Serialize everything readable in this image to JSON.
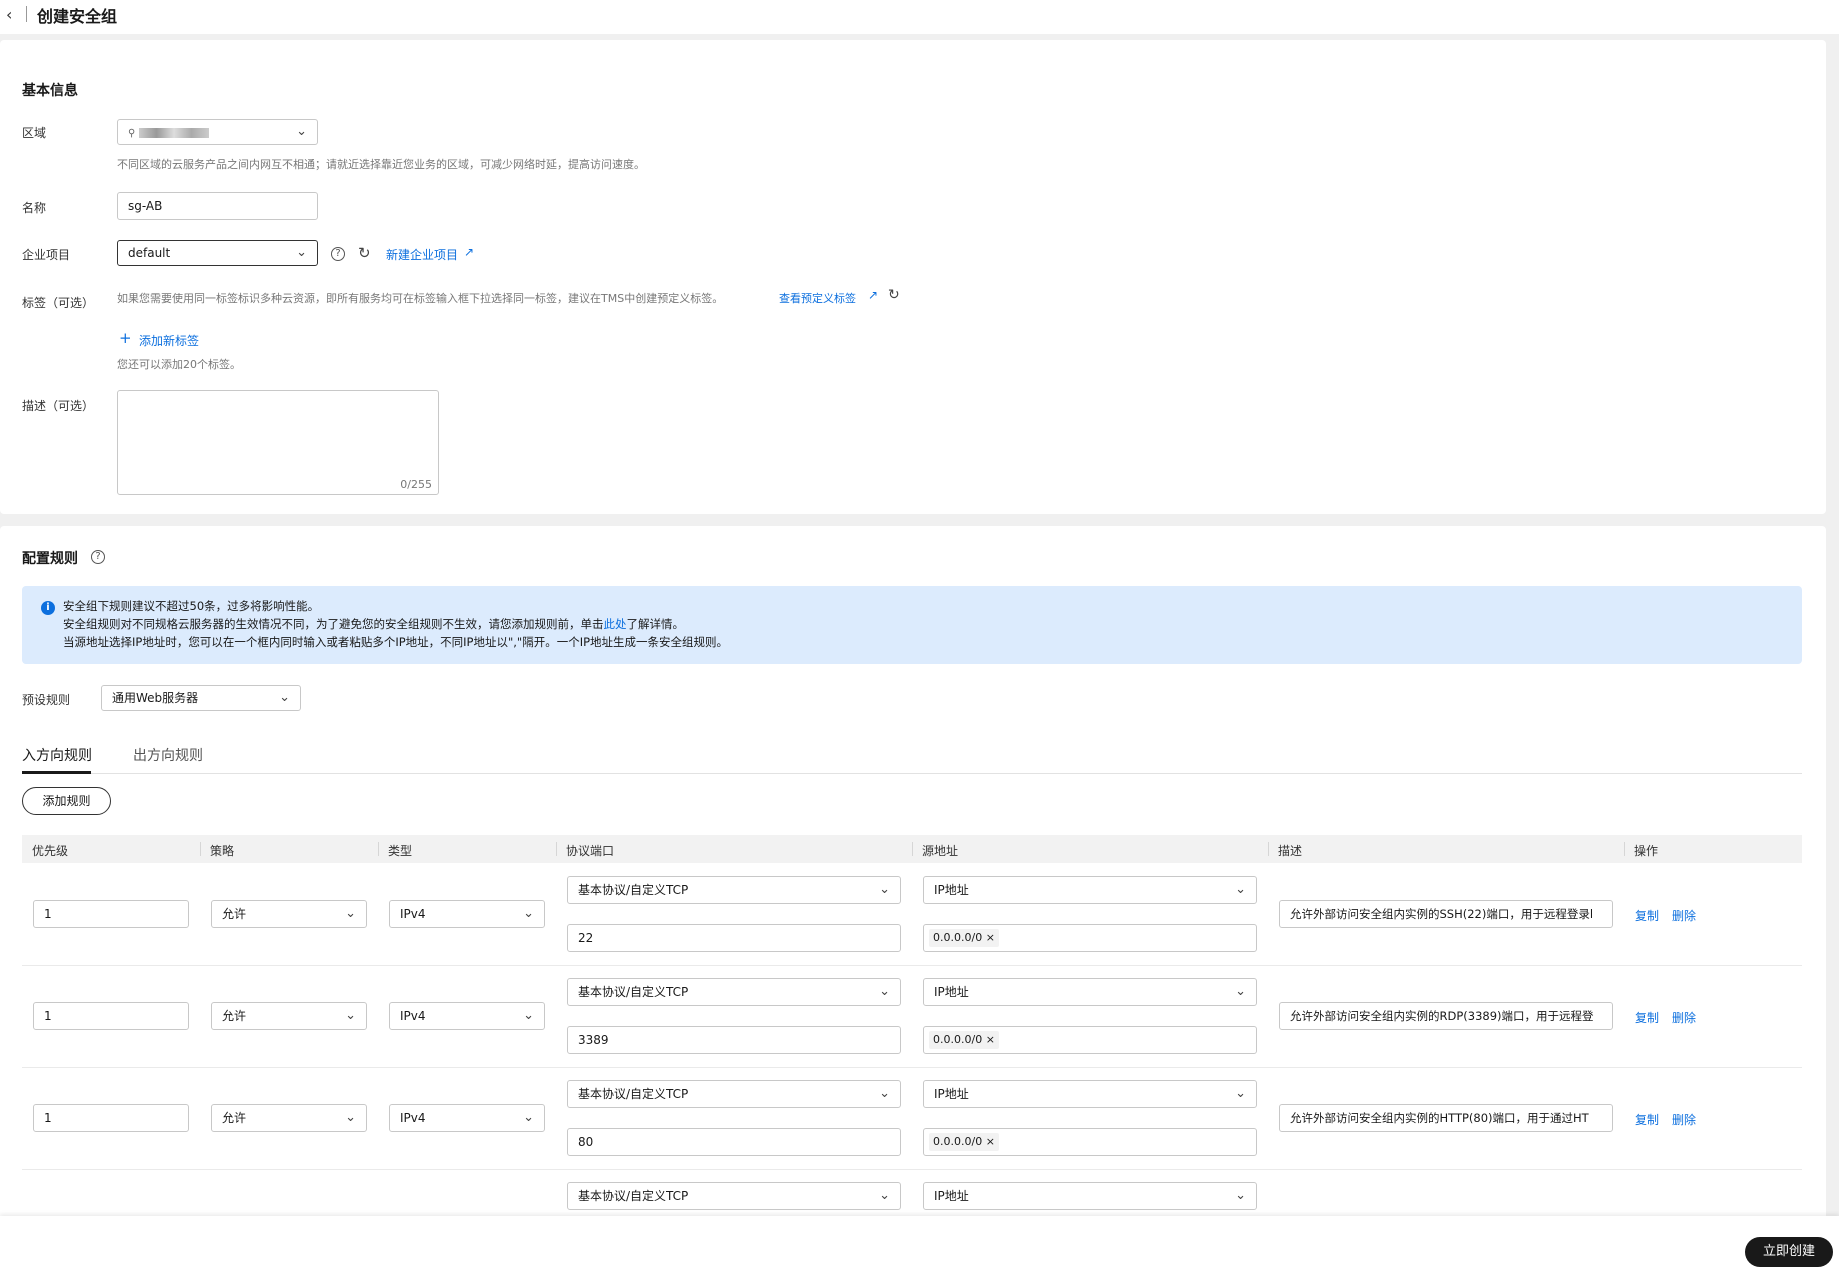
{
  "page": {
    "title": "创建安全组"
  },
  "basic": {
    "section_title": "基本信息",
    "region_label": "区域",
    "region_hint": "不同区域的云服务产品之间内网互不相通；请就近选择靠近您业务的区域，可减少网络时延，提高访问速度。",
    "name_label": "名称",
    "name_value": "sg-AB",
    "project_label": "企业项目",
    "project_value": "default",
    "new_project_link": "新建企业项目",
    "tag_label": "标签（可选）",
    "tag_hint": "如果您需要使用同一标签标识多种云资源，即所有服务均可在标签输入框下拉选择同一标签，建议在TMS中创建预定义标签。",
    "view_tags_link": "查看预定义标签",
    "add_tag_link": "添加新标签",
    "tag_quota": "您还可以添加20个标签。",
    "desc_label": "描述（可选）",
    "desc_counter": "0/255"
  },
  "rules": {
    "section_title": "配置规则",
    "alert_lines": [
      "安全组下规则建议不超过50条，过多将影响性能。",
      "安全组规则对不同规格云服务器的生效情况不同，为了避免您的安全组规则不生效，请您添加规则前，单击",
      "此处",
      "了解详情。",
      "当源地址选择IP地址时，您可以在一个框内同时输入或者粘贴多个IP地址，不同IP地址以\",\"隔开。一个IP地址生成一条安全组规则。"
    ],
    "preset_label": "预设规则",
    "preset_value": "通用Web服务器",
    "tabs": [
      "入方向规则",
      "出方向规则"
    ],
    "add_rule_button": "添加规则",
    "columns": [
      "优先级",
      "策略",
      "类型",
      "协议端口",
      "源地址",
      "描述",
      "操作"
    ],
    "rows": [
      {
        "priority": "1",
        "policy": "允许",
        "type": "IPv4",
        "protocol": "基本协议/自定义TCP",
        "port": "22",
        "source_type": "IP地址",
        "source_ip": "0.0.0.0/0",
        "desc": "允许外部访问安全组内实例的SSH(22)端口，用于远程登录l",
        "copy": "复制",
        "delete": "删除"
      },
      {
        "priority": "1",
        "policy": "允许",
        "type": "IPv4",
        "protocol": "基本协议/自定义TCP",
        "port": "3389",
        "source_type": "IP地址",
        "source_ip": "0.0.0.0/0",
        "desc": "允许外部访问安全组内实例的RDP(3389)端口，用于远程登",
        "copy": "复制",
        "delete": "删除"
      },
      {
        "priority": "1",
        "policy": "允许",
        "type": "IPv4",
        "protocol": "基本协议/自定义TCP",
        "port": "80",
        "source_type": "IP地址",
        "source_ip": "0.0.0.0/0",
        "desc": "允许外部访问安全组内实例的HTTP(80)端口，用于通过HT",
        "copy": "复制",
        "delete": "删除"
      },
      {
        "protocol": "基本协议/自定义TCP",
        "source_type": "IP地址"
      }
    ]
  },
  "footer": {
    "create_button": "立即创建"
  }
}
